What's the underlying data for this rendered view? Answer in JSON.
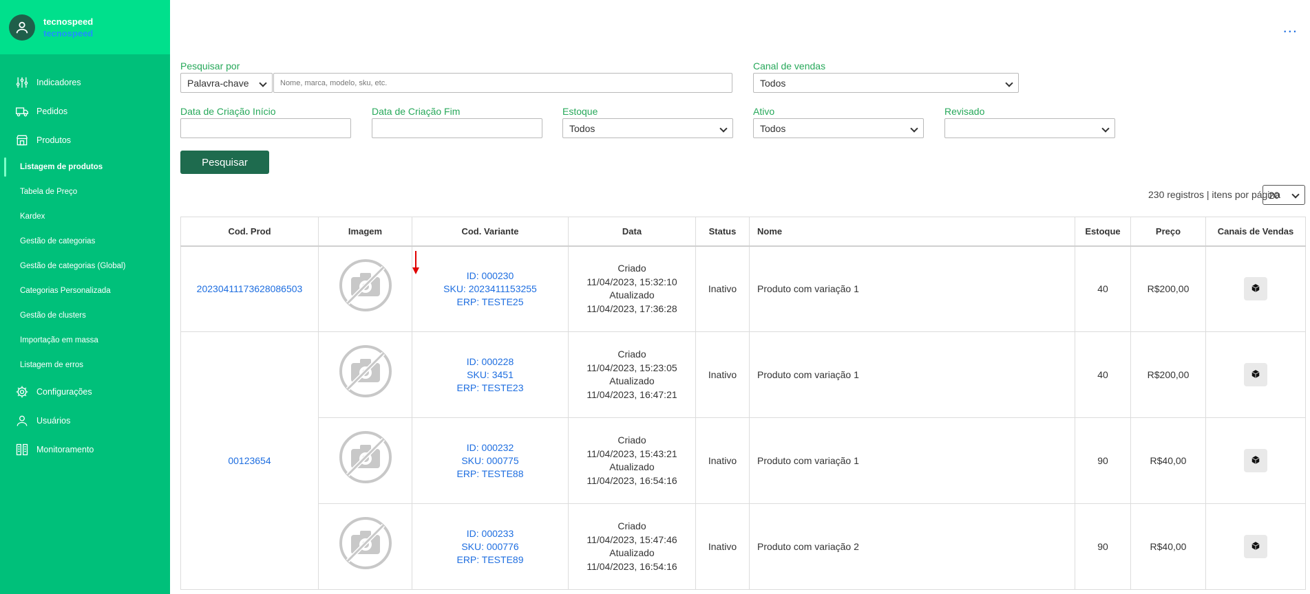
{
  "sidebar": {
    "brand_top": "tecnospeed",
    "brand_bottom": "tecnospeed",
    "items": [
      {
        "label": "Indicadores"
      },
      {
        "label": "Pedidos"
      },
      {
        "label": "Produtos"
      }
    ],
    "sub_items": [
      {
        "label": "Listagem de produtos"
      },
      {
        "label": "Tabela de Preço"
      },
      {
        "label": "Kardex"
      },
      {
        "label": "Gestão de categorias"
      },
      {
        "label": "Gestão de categorias (Global)"
      },
      {
        "label": "Categorias Personalizada"
      },
      {
        "label": "Gestão de clusters"
      },
      {
        "label": "Importação em massa"
      },
      {
        "label": "Listagem de erros"
      }
    ],
    "bottom_items": [
      {
        "label": "Configurações"
      },
      {
        "label": "Usuários"
      },
      {
        "label": "Monitoramento"
      }
    ]
  },
  "header": {
    "more_label": "..."
  },
  "filters": {
    "search_by_label": "Pesquisar por",
    "search_by_value": "Palavra-chave",
    "search_placeholder": "Nome, marca, modelo, sku, etc.",
    "channel_label": "Canal de vendas",
    "channel_value": "Todos",
    "created_start_label": "Data de Criação Início",
    "created_end_label": "Data de Criação Fim",
    "stock_label": "Estoque",
    "stock_value": "Todos",
    "active_label": "Ativo",
    "active_value": "Todos",
    "reviewed_label": "Revisado",
    "reviewed_value": "",
    "search_button": "Pesquisar"
  },
  "pagination": {
    "records_text": "230 registros | itens por página",
    "per_page": "20"
  },
  "table": {
    "headers": [
      "Cod. Prod",
      "Imagem",
      "Cod. Variante",
      "Data",
      "Status",
      "Nome",
      "Estoque",
      "Preço",
      "Canais de Vendas"
    ],
    "no_photo_label": "SEM FOTO",
    "groups": [
      {
        "cod_prod": "20230411173628086503",
        "rows": [
          {
            "id": "ID: 000230",
            "sku": "SKU: 2023411153255",
            "erp": "ERP: TESTE25",
            "created_label": "Criado",
            "created": "11/04/2023, 15:32:10",
            "updated_label": "Atualizado",
            "updated": "11/04/2023, 17:36:28",
            "status": "Inativo",
            "name": "Produto com variação 1",
            "stock": "40",
            "price": "R$200,00"
          }
        ]
      },
      {
        "cod_prod": "00123654",
        "rows": [
          {
            "id": "ID: 000228",
            "sku": "SKU: 3451",
            "erp": "ERP: TESTE23",
            "created_label": "Criado",
            "created": "11/04/2023, 15:23:05",
            "updated_label": "Atualizado",
            "updated": "11/04/2023, 16:47:21",
            "status": "Inativo",
            "name": "Produto com variação 1",
            "stock": "40",
            "price": "R$200,00"
          },
          {
            "id": "ID: 000232",
            "sku": "SKU: 000775",
            "erp": "ERP: TESTE88",
            "created_label": "Criado",
            "created": "11/04/2023, 15:43:21",
            "updated_label": "Atualizado",
            "updated": "11/04/2023, 16:54:16",
            "status": "Inativo",
            "name": "Produto com variação 1",
            "stock": "90",
            "price": "R$40,00"
          },
          {
            "id": "ID: 000233",
            "sku": "SKU: 000776",
            "erp": "ERP: TESTE89",
            "created_label": "Criado",
            "created": "11/04/2023, 15:47:46",
            "updated_label": "Atualizado",
            "updated": "11/04/2023, 16:54:16",
            "status": "Inativo",
            "name": "Produto com variação 2",
            "stock": "90",
            "price": "R$40,00"
          }
        ]
      }
    ]
  },
  "colors": {
    "sidebar": "#00c07a",
    "sidebar_header": "#00e08c",
    "label_green": "#27a85a",
    "button": "#1e6b4e",
    "link": "#1e6ee0",
    "arrow": "#e00000"
  }
}
